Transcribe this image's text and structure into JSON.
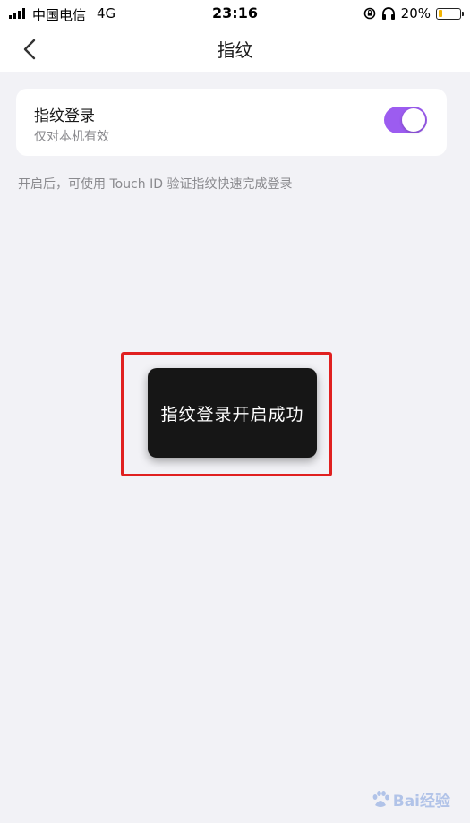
{
  "status_bar": {
    "carrier": "中国电信",
    "network": "4G",
    "time": "23:16",
    "battery_percent": "20%",
    "battery_level": 0.2,
    "icons": [
      "signal-icon",
      "rotation-lock-icon",
      "headphones-icon",
      "battery-icon"
    ]
  },
  "nav": {
    "title": "指纹",
    "back_icon": "chevron-left-icon"
  },
  "setting": {
    "title": "指纹登录",
    "subtitle": "仅对本机有效",
    "toggle_on": true,
    "toggle_color": "#9c5cf0"
  },
  "hint": "开启后，可使用 Touch ID 验证指纹快速完成登录",
  "toast": {
    "message": "指纹登录开启成功"
  },
  "annotation": {
    "color": "#e02020"
  },
  "watermark": {
    "text": "Bai经验",
    "icon": "baidu-paw-icon"
  }
}
